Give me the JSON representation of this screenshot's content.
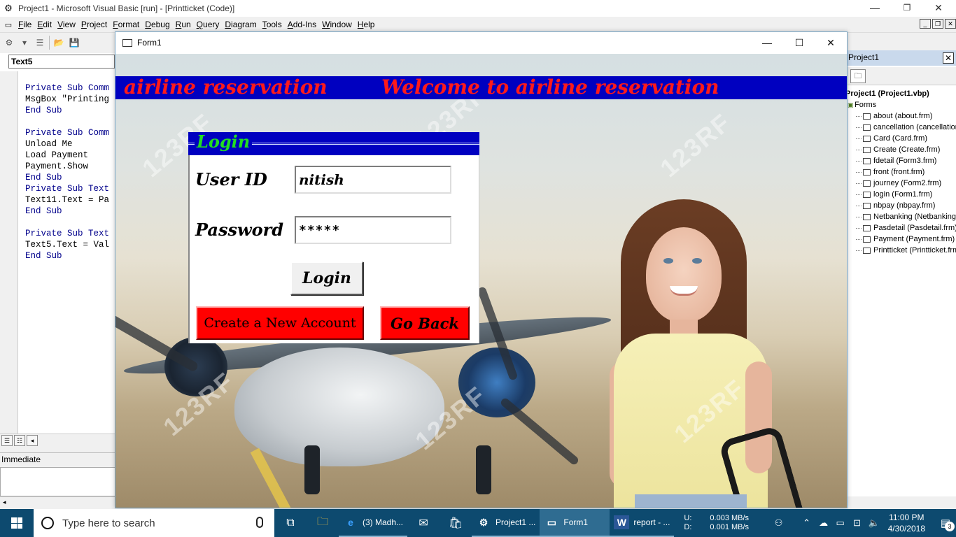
{
  "ide": {
    "title": "Project1 - Microsoft Visual Basic [run] - [Printticket (Code)]",
    "menu": [
      {
        "acc": "F",
        "rest": "ile"
      },
      {
        "acc": "E",
        "rest": "dit"
      },
      {
        "acc": "V",
        "rest": "iew"
      },
      {
        "acc": "P",
        "rest": "roject"
      },
      {
        "acc": "F",
        "rest": "ormat"
      },
      {
        "acc": "D",
        "rest": "ebug"
      },
      {
        "acc": "R",
        "rest": "un"
      },
      {
        "acc": "Q",
        "rest": "uery"
      },
      {
        "acc": "D",
        "rest": "iagram"
      },
      {
        "acc": "T",
        "rest": "ools"
      },
      {
        "acc": "A",
        "rest": "dd-Ins"
      },
      {
        "acc": "W",
        "rest": "indow"
      },
      {
        "acc": "H",
        "rest": "elp"
      }
    ],
    "object_combo": "Text5",
    "code_lines": [
      "",
      "Private Sub Comm",
      "MsgBox \"Printing",
      "End Sub",
      "",
      "Private Sub Comm",
      "Unload Me",
      "Load Payment",
      "Payment.Show",
      "End Sub",
      "Private Sub Text",
      "Text11.Text = Pa",
      "End Sub",
      "",
      "Private Sub Text",
      "Text5.Text = Val",
      "End Sub"
    ],
    "immediate_title": "Immediate"
  },
  "project": {
    "title": "Project1",
    "root": "Project1 (Project1.vbp)",
    "folder": "Forms",
    "items": [
      "about (about.frm)",
      "cancellation (cancellation.",
      "Card (Card.frm)",
      "Create (Create.frm)",
      "fdetail (Form3.frm)",
      "front (front.frm)",
      "journey (Form2.frm)",
      "login (Form1.frm)",
      "nbpay (nbpay.frm)",
      "Netbanking (Netbanking.f",
      "Pasdetail (Pasdetail.frm)",
      "Payment (Payment.frm)",
      "Printticket (Printticket.frm"
    ]
  },
  "form": {
    "title": "Form1",
    "header_left": "airline reservation",
    "header_right": "Welcome to airline reservation",
    "watermark": "123RF",
    "login_title": "Login",
    "user_id_label": "User ID",
    "password_label": "Password",
    "user_id_value": "nitish",
    "password_value": "*****",
    "login_button": "Login",
    "create_account_button": "Create a New Account",
    "go_back_button": "Go Back"
  },
  "taskbar": {
    "search_placeholder": "Type here to search",
    "apps": [
      {
        "name": "(3) Madh...",
        "icon": "edge-icon",
        "glyph": "e"
      },
      {
        "name": "Project1 ...",
        "icon": "vb6-icon",
        "glyph": "⚙"
      },
      {
        "name": "Form1",
        "icon": "form-icon",
        "glyph": "▭"
      },
      {
        "name": "report - ...",
        "icon": "word-icon",
        "glyph": "W"
      }
    ],
    "net": {
      "u_label": "U:",
      "d_label": "D:",
      "upload": "0.003 MB/s",
      "download": "0.001 MB/s"
    },
    "time": "11:00 PM",
    "date": "4/30/2018",
    "notifications": "3"
  },
  "colors": {
    "header_band": "#0000c0",
    "header_text": "#ff1a1a",
    "login_title": "#22dd22",
    "red_buttons": "#ff0000",
    "taskbar": "#0d4a6f"
  }
}
